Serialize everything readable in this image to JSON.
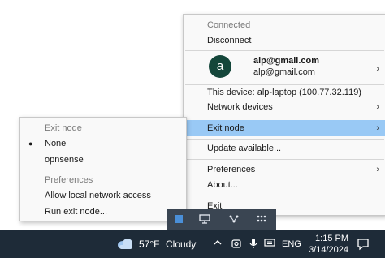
{
  "main_menu": {
    "status": "Connected",
    "disconnect": "Disconnect",
    "account": {
      "avatar_letter": "a",
      "primary": "alp@gmail.com",
      "secondary": "alp@gmail.com"
    },
    "this_device": "This device: alp-laptop (100.77.32.119)",
    "network_devices": "Network devices",
    "exit_node": "Exit node",
    "update": "Update available...",
    "preferences": "Preferences",
    "about": "About...",
    "exit": "Exit",
    "chevron": "›"
  },
  "sub_menu": {
    "exit_node_header": "Exit node",
    "none": "None",
    "opnsense": "opnsense",
    "preferences_header": "Preferences",
    "allow_local": "Allow local network access",
    "run_exit_node": "Run exit node...",
    "bullet": "●"
  },
  "taskbar": {
    "weather_temp": "57°F",
    "weather_condition": "Cloudy",
    "language": "ENG",
    "time": "1:15 PM",
    "date": "3/14/2024"
  },
  "colors": {
    "highlight": "#99c9f5",
    "taskbar": "#1e2b38",
    "avatar": "#14463a"
  }
}
